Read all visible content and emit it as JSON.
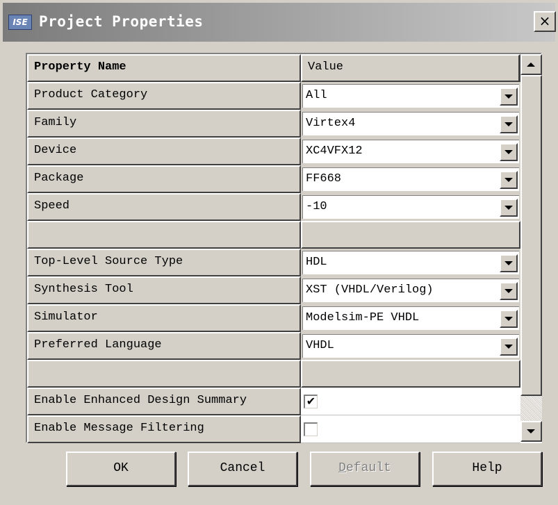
{
  "window": {
    "title": "Project Properties",
    "app_icon_text": "ISE",
    "close_label": "×"
  },
  "grid": {
    "header": {
      "name": "Property Name",
      "value": "Value"
    },
    "rows": [
      {
        "name": "Product Category",
        "value": "All",
        "type": "combo"
      },
      {
        "name": "Family",
        "value": "Virtex4",
        "type": "combo"
      },
      {
        "name": "Device",
        "value": "XC4VFX12",
        "type": "combo"
      },
      {
        "name": "Package",
        "value": "FF668",
        "type": "combo"
      },
      {
        "name": "Speed",
        "value": "-10",
        "type": "combo"
      },
      {
        "name": "",
        "value": "",
        "type": "empty"
      },
      {
        "name": "Top-Level Source Type",
        "value": "HDL",
        "type": "combo"
      },
      {
        "name": "Synthesis Tool",
        "value": "XST (VHDL/Verilog)",
        "type": "combo"
      },
      {
        "name": "Simulator",
        "value": "Modelsim-PE VHDL",
        "type": "combo"
      },
      {
        "name": "Preferred Language",
        "value": "VHDL",
        "type": "combo"
      },
      {
        "name": "",
        "value": "",
        "type": "empty"
      },
      {
        "name": "Enable Enhanced Design Summary",
        "value": "✔",
        "type": "checkbox",
        "checked": true
      },
      {
        "name": "Enable Message Filtering",
        "value": "",
        "type": "checkbox",
        "checked": false
      }
    ]
  },
  "buttons": {
    "ok": "OK",
    "cancel": "Cancel",
    "default_first": "D",
    "default_rest": "efault",
    "help": "Help"
  }
}
